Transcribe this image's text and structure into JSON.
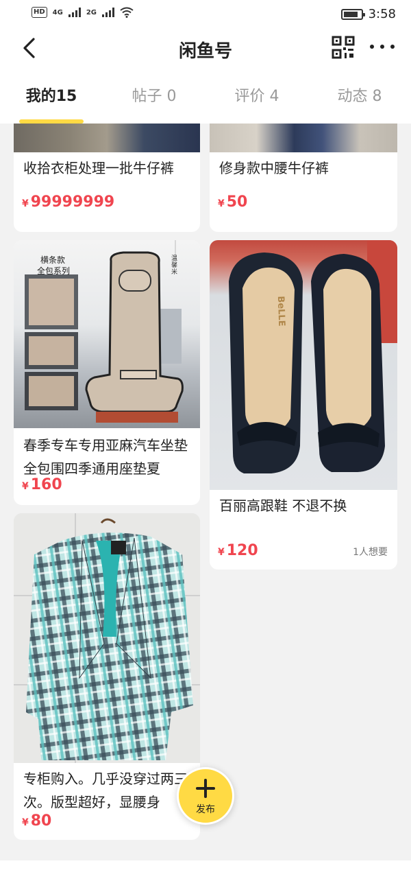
{
  "status_bar": {
    "hd": "HD",
    "net1": "4G",
    "net2": "2G",
    "time": "3:58",
    "battery_level": 0.85
  },
  "header": {
    "title": "闲鱼号",
    "back_icon": "chevron-left-icon",
    "qr_icon": "qr-code-icon",
    "more_icon": "more-horizontal-icon"
  },
  "tabs": [
    {
      "label": "我的15",
      "active": true
    },
    {
      "label": "帖子 0",
      "active": false
    },
    {
      "label": "评价 4",
      "active": false
    },
    {
      "label": "动态 8",
      "active": false
    }
  ],
  "products": [
    {
      "title": "收拾衣柜处理一批牛仔裤",
      "currency": "¥",
      "price": "99999999"
    },
    {
      "title": "修身款中腰牛仔裤",
      "currency": "¥",
      "price": "50"
    },
    {
      "title": "春季专车专用亚麻汽车坐垫全包围四季通用座垫夏",
      "currency": "¥",
      "price": "160",
      "image_text": [
        "横条款",
        "全包系列",
        "温馨米"
      ]
    },
    {
      "title": "百丽高跟鞋 不退不换",
      "currency": "¥",
      "price": "120",
      "wants": "1人想要",
      "image_text": [
        "BeLLE"
      ]
    },
    {
      "title": "专柜购入。几乎没穿过两三次。版型超好，显腰身",
      "currency": "¥",
      "price": "80"
    }
  ],
  "fab": {
    "label": "发布",
    "icon": "plus-icon"
  },
  "colors": {
    "accent": "#ffda44",
    "price": "#f0454f",
    "background": "#f2f2f2"
  }
}
